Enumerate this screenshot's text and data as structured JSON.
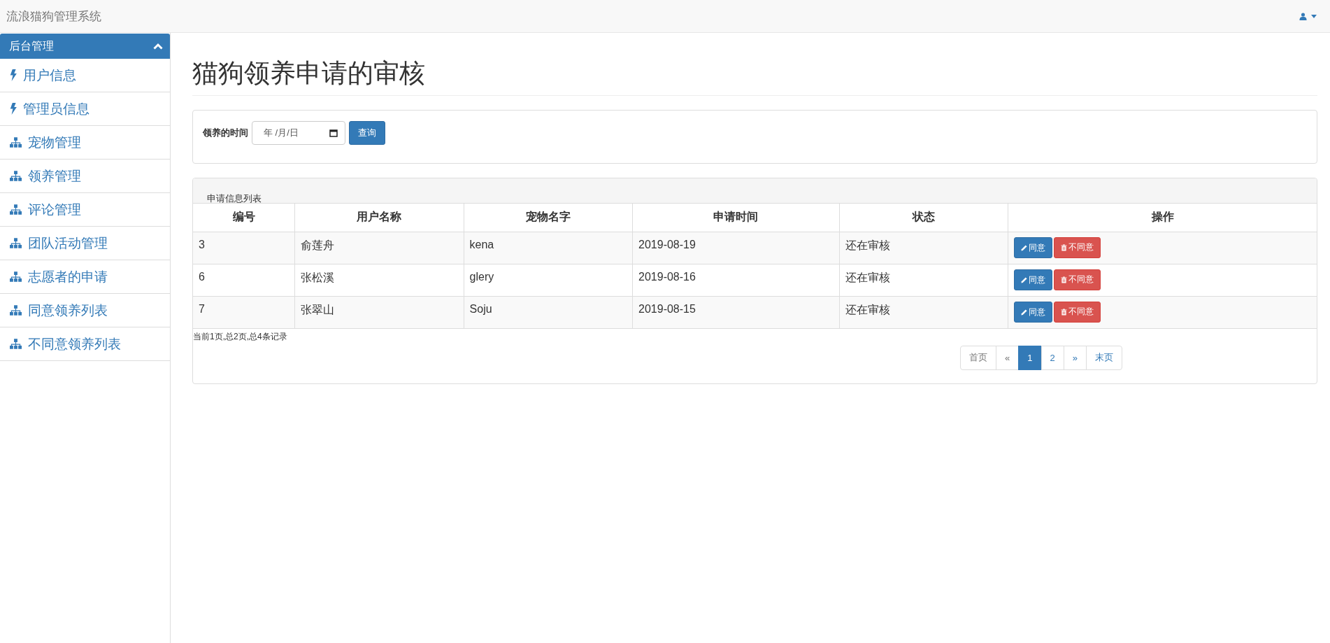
{
  "navbar": {
    "brand": "流浪猫狗管理系统"
  },
  "sidebar": {
    "header": "后台管理",
    "expanded": true,
    "items": [
      {
        "label": "用户信息",
        "kind": "bolt"
      },
      {
        "label": "管理员信息",
        "kind": "bolt"
      },
      {
        "label": "宠物管理",
        "kind": "sitemap"
      },
      {
        "label": "领养管理",
        "kind": "sitemap"
      },
      {
        "label": "评论管理",
        "kind": "sitemap"
      },
      {
        "label": "团队活动管理",
        "kind": "sitemap"
      },
      {
        "label": "志愿者的申请",
        "kind": "sitemap"
      },
      {
        "label": "同意领养列表",
        "kind": "sitemap"
      },
      {
        "label": "不同意领养列表",
        "kind": "sitemap"
      }
    ]
  },
  "page_title": "猫狗领养申请的审核",
  "search": {
    "label": "领养的时间",
    "placeholder": "年 /月/日",
    "button": "查询"
  },
  "table": {
    "caption": "申请信息列表",
    "columns": [
      "编号",
      "用户名称",
      "宠物名字",
      "申请时间",
      "状态",
      "操作"
    ],
    "rows": [
      {
        "cells": [
          "3",
          "俞莲舟",
          "kena",
          "2019-08-19",
          "还在审核"
        ],
        "actions": [
          "同意",
          "不同意"
        ]
      },
      {
        "cells": [
          "6",
          "张松溪",
          "glery",
          "2019-08-16",
          "还在审核"
        ],
        "actions": [
          "同意",
          "不同意"
        ]
      },
      {
        "cells": [
          "7",
          "张翠山",
          "Soju",
          "2019-08-15",
          "还在审核"
        ],
        "actions": [
          "同意",
          "不同意"
        ]
      }
    ]
  },
  "summary": "当前1页,总2页,总4条记录",
  "pagination": [
    {
      "label": "首页",
      "selected": false
    },
    {
      "label": "«",
      "selected": false
    },
    {
      "label": "1",
      "selected": true
    },
    {
      "label": "2",
      "selected": false
    },
    {
      "label": "»",
      "selected": false
    },
    {
      "label": "末页",
      "selected": false
    }
  ]
}
